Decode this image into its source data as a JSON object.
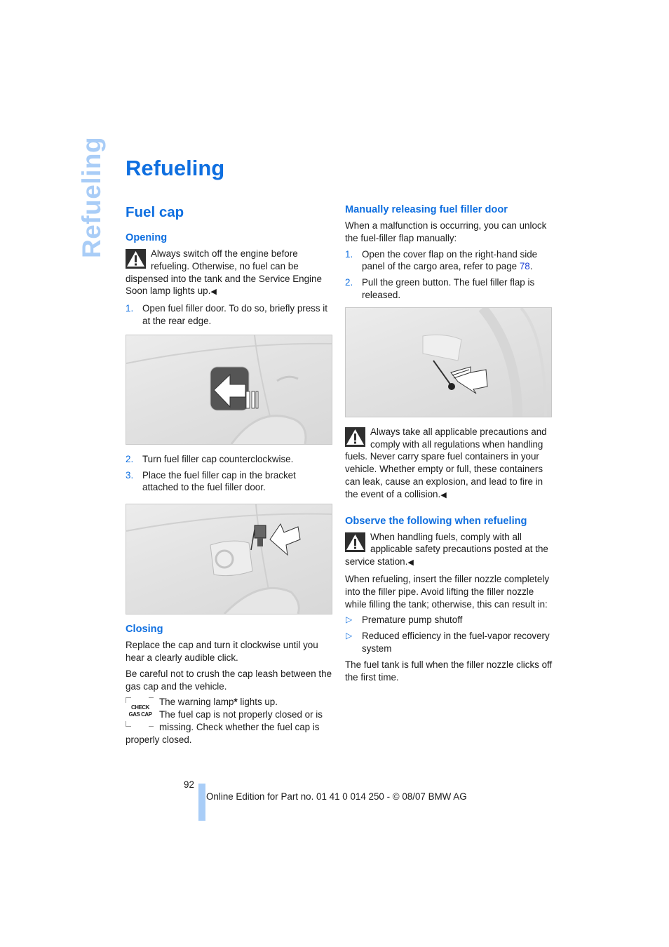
{
  "side_tab": "Refueling",
  "page_title": "Refueling",
  "left": {
    "section_title": "Fuel cap",
    "opening": {
      "title": "Opening",
      "warning": "Always switch off the engine before refueling. Otherwise, no fuel can be dispensed into the tank and the Service Engine Soon lamp lights up.",
      "steps": [
        {
          "num": "1.",
          "text": "Open fuel filler door. To do so, briefly press it at the rear edge."
        },
        {
          "num": "2.",
          "text": "Turn fuel filler cap counterclockwise."
        },
        {
          "num": "3.",
          "text": "Place the fuel filler cap in the bracket attached to the fuel filler door."
        }
      ]
    },
    "closing": {
      "title": "Closing",
      "para1": "Replace the cap and turn it clockwise until you hear a clearly audible click.",
      "para2": "Be careful not to crush the cap leash between the gas cap and the vehicle.",
      "lamp_icon_line1": "CHECK",
      "lamp_icon_line2": "GAS CAP",
      "lamp_text_a": "The warning lamp",
      "lamp_asterisk": "*",
      "lamp_text_b": " lights up.",
      "lamp_text_c": "The fuel cap is not properly closed or is missing. Check whether the fuel cap is properly closed."
    }
  },
  "right": {
    "manual": {
      "title": "Manually releasing fuel filler door",
      "intro": "When a malfunction is occurring, you can unlock the fuel-filler flap manually:",
      "step1_num": "1.",
      "step1_text": "Open the cover flap on the right-hand side panel of the cargo area, refer to page ",
      "step1_link": "78",
      "step1_end": ".",
      "step2_num": "2.",
      "step2_text": "Pull the green button. The fuel filler flap is released.",
      "warning": "Always take all applicable precautions and comply with all regulations when handling fuels. Never carry spare fuel containers in your vehicle. Whether empty or full, these containers can leak, cause an explosion, and lead to fire in the event of a collision."
    },
    "observe": {
      "title": "Observe the following when refueling",
      "warning": "When handling fuels, comply with all applicable safety precautions posted at the service station.",
      "para": "When refueling, insert the filler nozzle completely into the filler pipe. Avoid lifting the filler nozzle while filling the tank; otherwise, this can result in:",
      "bullets": [
        "Premature pump shutoff",
        "Reduced efficiency in the fuel-vapor recovery system"
      ],
      "closing": "The fuel tank is full when the filler nozzle clicks off the first time."
    }
  },
  "end_mark": "◀",
  "bullet_glyph": "▷",
  "footer": {
    "page_number": "92",
    "text": "Online Edition for Part no. 01 41 0 014 250 - © 08/07 BMW AG"
  }
}
